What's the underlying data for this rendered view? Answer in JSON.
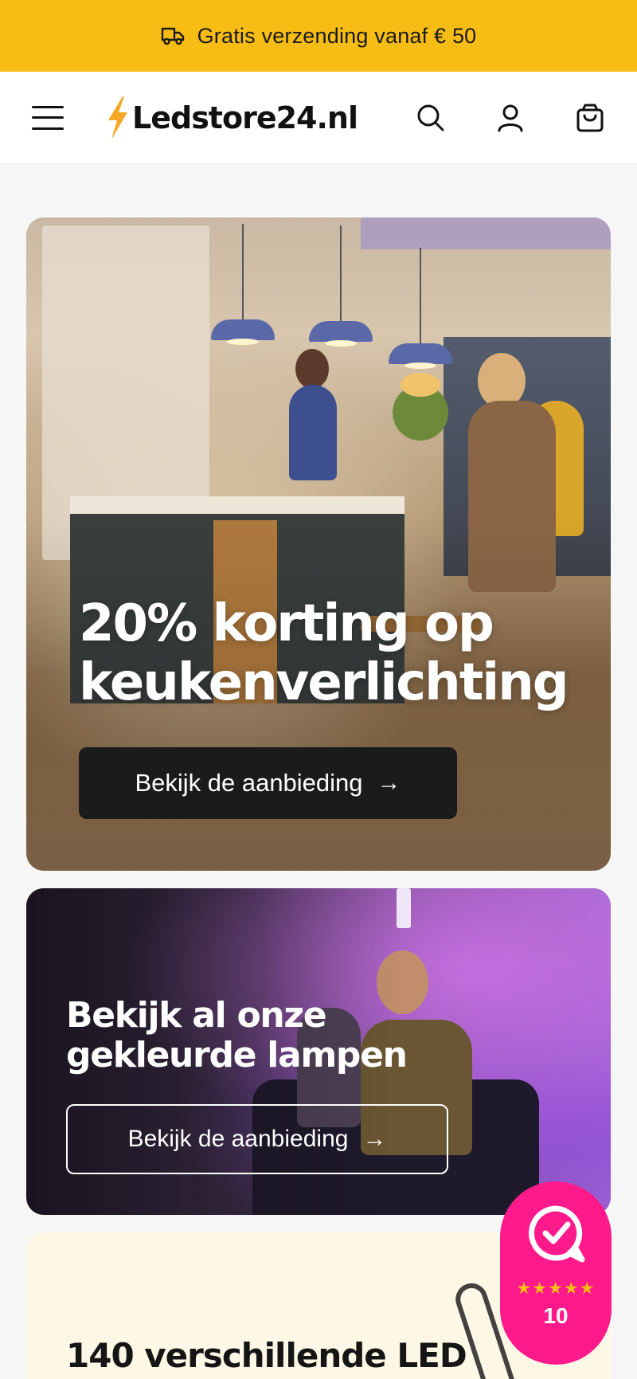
{
  "promo_bar": {
    "icon": "truck-icon",
    "text": "Gratis verzending vanaf € 50",
    "bg_color": "#f8bd14"
  },
  "header": {
    "menu_icon": "hamburger-menu-icon",
    "logo_text": "Ledstore24.nl",
    "logo_icon": "lightning-bolt-icon",
    "icons": [
      "search-icon",
      "user-icon",
      "cart-icon"
    ]
  },
  "hero": {
    "title": "20% korting op keukenverlichting",
    "button_label": "Bekijk de aanbieding",
    "button_icon": "arrow-right-icon"
  },
  "colored_lamps_card": {
    "title": "Bekijk al onze gekleurde lampen",
    "button_label": "Bekijk de aanbieding",
    "button_icon": "arrow-right-icon"
  },
  "products_card": {
    "title": "140 verschillende LED"
  },
  "review_badge": {
    "icon": "review-check-icon",
    "stars": "★★★★★",
    "score": "10",
    "bg_color": "#ff1a8c"
  }
}
